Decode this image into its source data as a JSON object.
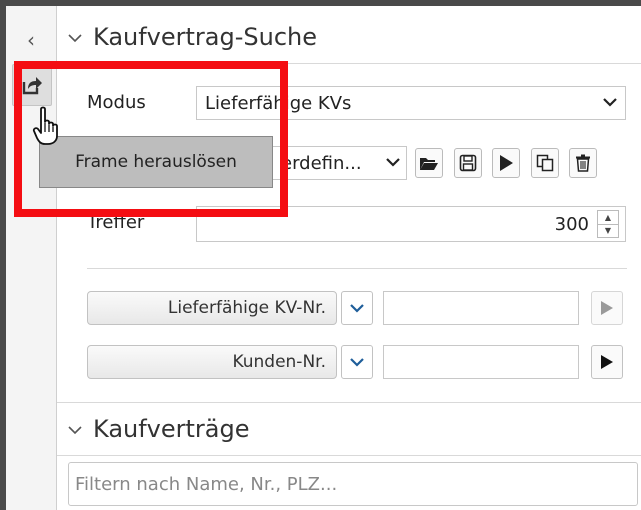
{
  "left_bar": {
    "collapse_glyph": "‹"
  },
  "search_section": {
    "title": "Kaufvertrag-Suche",
    "modus_label": "Modus",
    "modus_value": "Lieferfähige KVs",
    "preset_value": "erdefin...",
    "treffer_label": "Treffer",
    "treffer_value": "300",
    "criteria": [
      {
        "label": "Lieferfähige KV-Nr.",
        "value": ""
      },
      {
        "label": "Kunden-Nr.",
        "value": ""
      }
    ]
  },
  "results_section": {
    "title": "Kaufverträge",
    "filter_placeholder": "Filtern nach Name, Nr., PLZ..."
  },
  "tooltip": {
    "text": "Frame herauslösen"
  },
  "colors": {
    "highlight": "#f40d12",
    "tooltip_bg": "#bdbdbd",
    "frame_border": "#4a4a4a"
  },
  "icons": [
    "chevron-left-icon",
    "detach-frame-icon",
    "folder-open-icon",
    "save-icon",
    "play-icon",
    "copy-icon",
    "trash-icon",
    "chevron-down-icon",
    "hand-cursor-icon"
  ]
}
